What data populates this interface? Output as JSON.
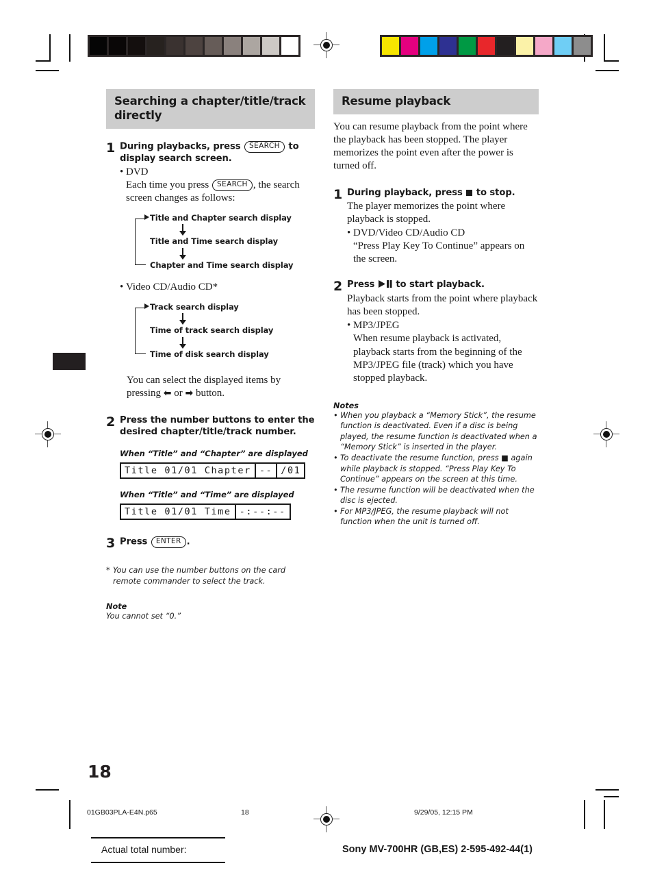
{
  "document": {
    "page_number": "18",
    "footer": {
      "filename": "01GB03PLA-E4N.p65",
      "page": "18",
      "timestamp": "9/29/05, 12:15 PM",
      "actual_total_label": "Actual total number:",
      "model_line": "Sony MV-700HR (GB,ES) 2-595-492-44(1)"
    },
    "calibration": {
      "gray_swatches": [
        "#050505",
        "#0a0707",
        "#140f0e",
        "#27221f",
        "#3a3230",
        "#4d4340",
        "#665c58",
        "#8a817d",
        "#aca6a1",
        "#cdc9c5",
        "#ffffff"
      ],
      "color_swatches": [
        "#f7e500",
        "#e5007f",
        "#00a0e9",
        "#2e3192",
        "#009944",
        "#e8272b",
        "#231f20",
        "#fbf2a8",
        "#f5a8c8",
        "#6fcef5",
        "#8d8d8d"
      ]
    }
  },
  "left_column": {
    "heading": "Searching a chapter/title/track directly",
    "step1": {
      "num": "1",
      "title_a": "During playbacks, press",
      "key_search": "SEARCH",
      "title_b": "to display search screen.",
      "bullet_dvd": "DVD",
      "dvd_line_a": "Each time you press",
      "dvd_key": "SEARCH",
      "dvd_line_b": ", the search screen changes as follows:",
      "dvd_flow": [
        "Title and Chapter search display",
        "Title and Time search display",
        "Chapter and Time search display"
      ],
      "bullet_vcd": "Video CD/Audio CD*",
      "vcd_flow": [
        "Track search display",
        "Time of track search display",
        "Time of disk search display"
      ],
      "select_note_a": "You can select the displayed items by pressing",
      "select_note_b": "or",
      "select_note_c": "button."
    },
    "step2": {
      "num": "2",
      "title": "Press the number buttons to enter the desired chapter/title/track number.",
      "caption_chapter": "When “Title” and “Chapter” are displayed",
      "lcd_chapter": [
        "Title 01/01 Chapter",
        "--",
        "/01"
      ],
      "caption_time": "When “Title” and “Time” are displayed",
      "lcd_time": [
        "Title 01/01 Time",
        "-:--:--"
      ]
    },
    "step3": {
      "num": "3",
      "title_a": "Press",
      "key_enter": "ENTER",
      "title_b": "."
    },
    "footnote": {
      "marker": "*",
      "text": "You can use the number buttons on the card remote commander to select the track."
    },
    "note": {
      "heading": "Note",
      "text": "You cannot set “0.”"
    }
  },
  "right_column": {
    "heading": "Resume playback",
    "intro": "You can resume playback from the point where the playback has been stopped. The player memorizes the point even after the power is turned off.",
    "step1": {
      "num": "1",
      "title_a": "During playback, press",
      "title_b": "to stop.",
      "body": "The player memorizes the point where playback is stopped.",
      "bullet_label": "DVD/Video CD/Audio CD",
      "bullet_text": "“Press Play Key To Continue” appears on the screen."
    },
    "step2": {
      "num": "2",
      "title_a": "Press",
      "title_b": "to start playback.",
      "body": "Playback starts from the point where playback has been stopped.",
      "bullet_label": "MP3/JPEG",
      "bullet_text": "When resume playback is activated, playback starts from the beginning of the MP3/JPEG file (track) which you have stopped playback."
    },
    "notes": {
      "heading": "Notes",
      "items": [
        "When you playback a “Memory Stick”, the resume function is deactivated. Even if a disc is being played, the resume function is deactivated when a “Memory Stick” is inserted in the player.",
        "To deactivate the resume function, press ■ again while playback is stopped. “Press Play Key To Continue” appears on the screen at this time.",
        "The resume function will be deactivated when the disc is ejected.",
        "For MP3/JPEG, the resume playback will not function when the unit is turned off."
      ]
    }
  }
}
